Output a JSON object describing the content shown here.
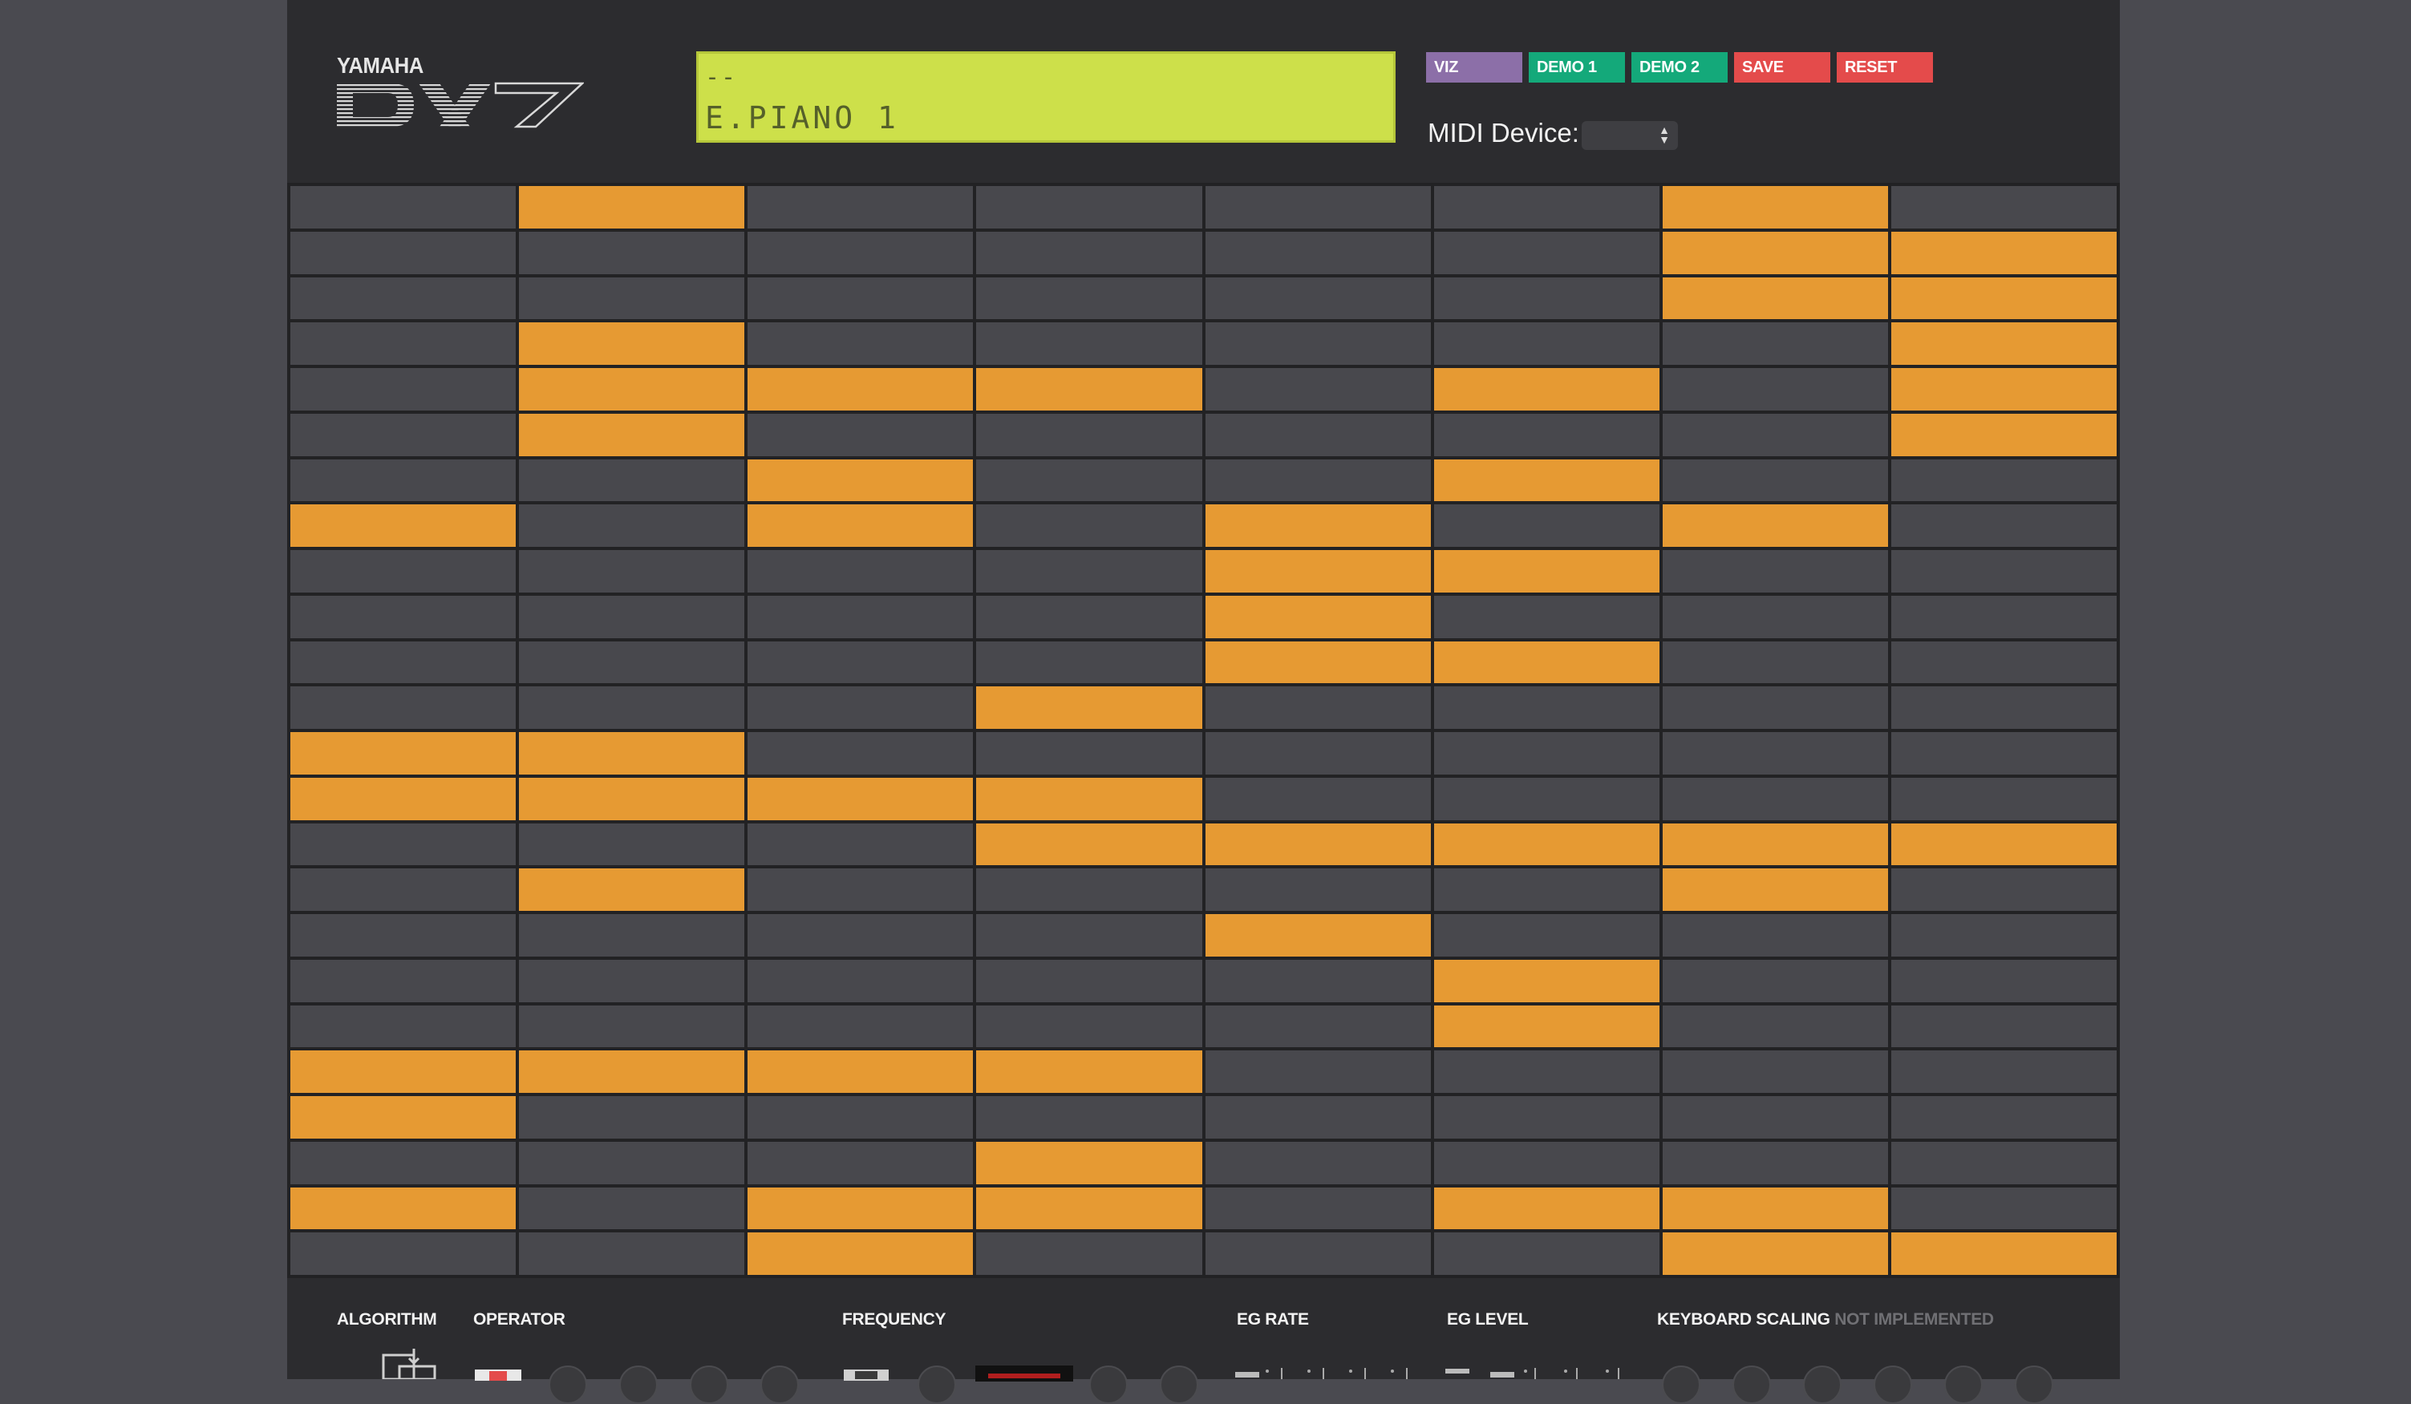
{
  "logo": {
    "brand": "YAMAHA",
    "model": "DX7"
  },
  "lcd": {
    "line1": "--",
    "line2": "E.PIANO 1"
  },
  "toolbar": {
    "buttons": [
      {
        "label": "VIZ",
        "color": "#8c6fa8"
      },
      {
        "label": "DEMO 1",
        "color": "#14a97a"
      },
      {
        "label": "DEMO 2",
        "color": "#14a97a"
      },
      {
        "label": "SAVE",
        "color": "#e44b4b"
      },
      {
        "label": "RESET",
        "color": "#e44b4b"
      }
    ]
  },
  "midi": {
    "label": "MIDI Device:",
    "selected": ""
  },
  "grid": {
    "columns": 8,
    "rows": 24,
    "active_color": "#e69a33",
    "inactive_color": "#48484d",
    "rows_state": [
      [
        0,
        1,
        0,
        0,
        0,
        0,
        1,
        0
      ],
      [
        0,
        0,
        0,
        0,
        0,
        0,
        1,
        1
      ],
      [
        0,
        0,
        0,
        0,
        0,
        0,
        1,
        1
      ],
      [
        0,
        1,
        0,
        0,
        0,
        0,
        0,
        1
      ],
      [
        0,
        1,
        1,
        1,
        0,
        1,
        0,
        1
      ],
      [
        0,
        1,
        0,
        0,
        0,
        0,
        0,
        1
      ],
      [
        0,
        0,
        1,
        0,
        0,
        1,
        0,
        0
      ],
      [
        1,
        0,
        1,
        0,
        1,
        0,
        1,
        0
      ],
      [
        0,
        0,
        0,
        0,
        1,
        1,
        0,
        0
      ],
      [
        0,
        0,
        0,
        0,
        1,
        0,
        0,
        0
      ],
      [
        0,
        0,
        0,
        0,
        1,
        1,
        0,
        0
      ],
      [
        0,
        0,
        0,
        1,
        0,
        0,
        0,
        0
      ],
      [
        1,
        1,
        0,
        0,
        0,
        0,
        0,
        0
      ],
      [
        1,
        1,
        1,
        1,
        0,
        0,
        0,
        0
      ],
      [
        0,
        0,
        0,
        1,
        1,
        1,
        1,
        1
      ],
      [
        0,
        1,
        0,
        0,
        0,
        0,
        1,
        0
      ],
      [
        0,
        0,
        0,
        0,
        1,
        0,
        0,
        0
      ],
      [
        0,
        0,
        0,
        0,
        0,
        1,
        0,
        0
      ],
      [
        0,
        0,
        0,
        0,
        0,
        1,
        0,
        0
      ],
      [
        1,
        1,
        1,
        1,
        0,
        0,
        0,
        0
      ],
      [
        1,
        0,
        0,
        0,
        0,
        0,
        0,
        0
      ],
      [
        0,
        0,
        0,
        1,
        0,
        0,
        0,
        0
      ],
      [
        1,
        0,
        1,
        1,
        0,
        1,
        1,
        0
      ],
      [
        0,
        0,
        1,
        0,
        0,
        0,
        1,
        1
      ]
    ]
  },
  "sections": {
    "algorithm": "ALGORITHM",
    "operator": "OPERATOR",
    "frequency": "FREQUENCY",
    "eg_rate": "EG RATE",
    "eg_level": "EG LEVEL",
    "keyboard_scaling": "KEYBOARD SCALING",
    "not_implemented": "NOT IMPLEMENTED"
  }
}
